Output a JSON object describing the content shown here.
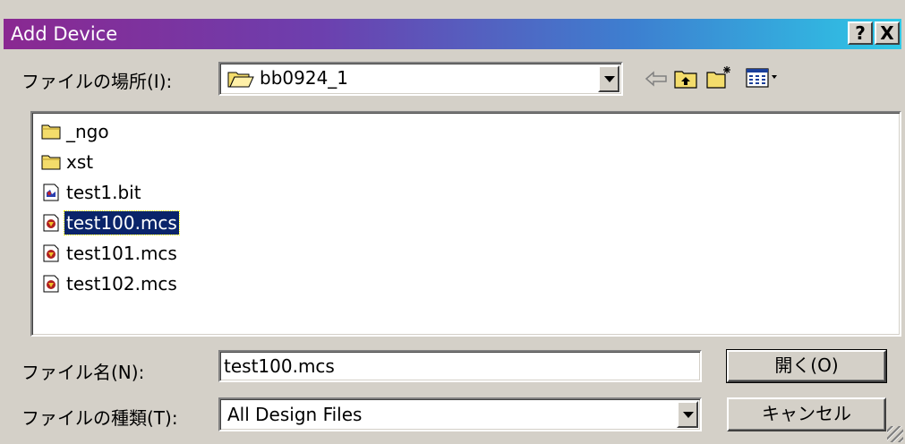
{
  "window": {
    "title": "Add Device",
    "help_button": "?",
    "close_button": "X"
  },
  "location": {
    "label": "ファイルの場所(I):",
    "value": "bb0924_1"
  },
  "toolbar": {
    "icons": [
      "back-icon",
      "up-folder-icon",
      "new-folder-icon",
      "view-menu-icon"
    ]
  },
  "files": [
    {
      "name": "_ngo",
      "type": "folder"
    },
    {
      "name": "xst",
      "type": "folder"
    },
    {
      "name": "test1.bit",
      "type": "bit"
    },
    {
      "name": "test100.mcs",
      "type": "mcs",
      "selected": true
    },
    {
      "name": "test101.mcs",
      "type": "mcs"
    },
    {
      "name": "test102.mcs",
      "type": "mcs"
    }
  ],
  "filename": {
    "label": "ファイル名(N):",
    "value": "test100.mcs"
  },
  "filetype": {
    "label": "ファイルの種類(T):",
    "value": "All Design Files"
  },
  "buttons": {
    "open": "開く(O)",
    "cancel": "キャンセル"
  },
  "colors": {
    "title_start": "#8a2891",
    "title_end": "#2ec8e6",
    "selection": "#0a246a",
    "face": "#d4d0c8"
  }
}
